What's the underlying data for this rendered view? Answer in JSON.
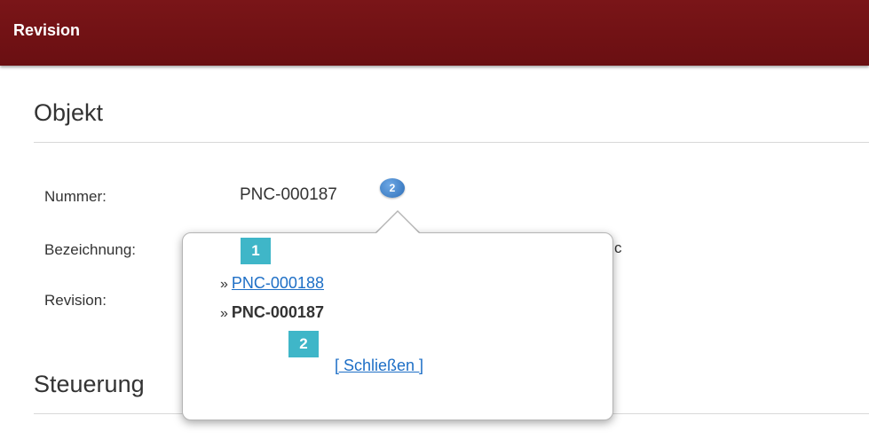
{
  "header": {
    "title": "Revision"
  },
  "sections": {
    "objekt": "Objekt",
    "steuerung": "Steuerung"
  },
  "fields": {
    "nummer_label": "Nummer:",
    "nummer_value": "PNC-000187",
    "revision_badge": "2",
    "bezeichnung_label": "Bezeichnung:",
    "revision_label": "Revision:",
    "partial_hidden": "c"
  },
  "popup": {
    "marker_1": "1",
    "marker_2": "2",
    "items": [
      {
        "bullet": "»",
        "text": "PNC-000188",
        "link": true
      },
      {
        "bullet": "»",
        "text": "PNC-000187",
        "link": false
      }
    ],
    "close_label": "[ Schließen ]"
  },
  "colors": {
    "header_bg": "#6a0f12",
    "link": "#1e6fc6",
    "marker": "#3fb6c8",
    "badge": "#2d6eb7"
  }
}
